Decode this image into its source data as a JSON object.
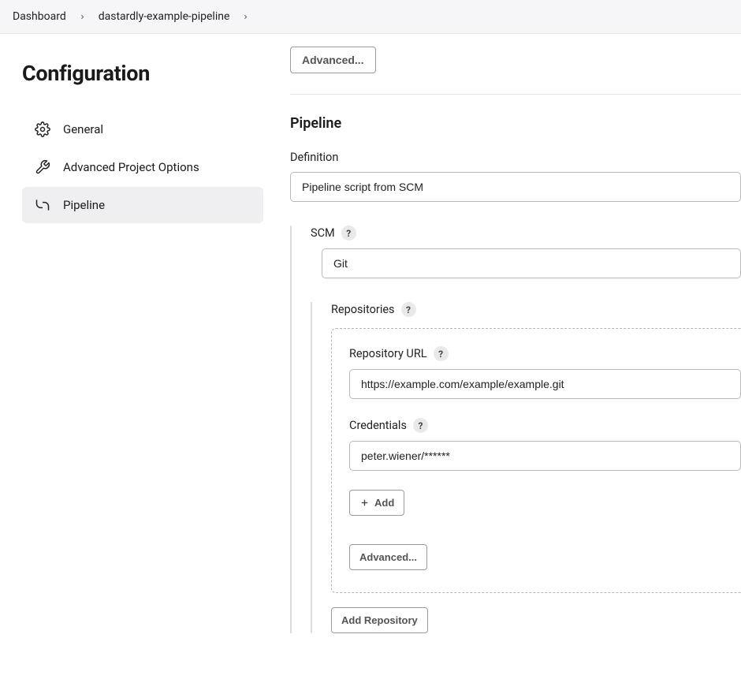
{
  "breadcrumb": {
    "items": [
      "Dashboard",
      "dastardly-example-pipeline"
    ]
  },
  "page_title": "Configuration",
  "sidebar": {
    "items": [
      {
        "label": "General"
      },
      {
        "label": "Advanced Project Options"
      },
      {
        "label": "Pipeline"
      }
    ]
  },
  "pipeline": {
    "advanced_btn": "Advanced...",
    "section_title": "Pipeline",
    "definition_label": "Definition",
    "definition_value": "Pipeline script from SCM",
    "scm_label": "SCM",
    "scm_value": "Git",
    "repositories_label": "Repositories",
    "repo_url_label": "Repository URL",
    "repo_url_value": "https://example.com/example/example.git",
    "credentials_label": "Credentials",
    "credentials_value": "peter.wiener/******",
    "add_btn": "Add",
    "advanced2_btn": "Advanced...",
    "add_repo_btn": "Add Repository"
  }
}
